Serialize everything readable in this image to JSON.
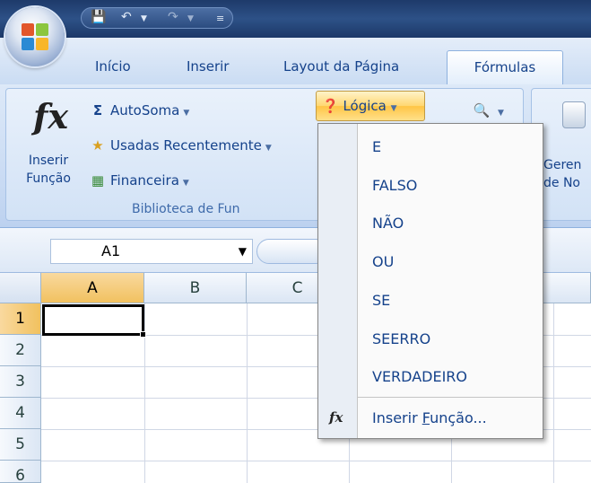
{
  "qat": {
    "icons": [
      "save-icon",
      "undo-icon",
      "redo-icon",
      "customize-icon"
    ]
  },
  "tabs": [
    {
      "label": "Início",
      "active": false
    },
    {
      "label": "Inserir",
      "active": false
    },
    {
      "label": "Layout da Página",
      "active": false
    },
    {
      "label": "Fórmulas",
      "active": true
    }
  ],
  "ribbon": {
    "insert_function": {
      "icon": "fx",
      "line1": "Inserir",
      "line2": "Função"
    },
    "autosum": {
      "icon": "Σ",
      "label": "AutoSoma"
    },
    "recent": {
      "label": "Usadas Recentemente"
    },
    "financial": {
      "label": "Financeira"
    },
    "logical": {
      "label": "Lógica"
    },
    "group_label": "Biblioteca de Fun",
    "right_text": {
      "line1": "Geren",
      "line2": "de No"
    }
  },
  "formula_bar": {
    "name_box": "A1"
  },
  "grid": {
    "columns": [
      "A",
      "B",
      "C"
    ],
    "rows": [
      "1",
      "2",
      "3",
      "4",
      "5",
      "6"
    ],
    "selected_cell": "A1"
  },
  "menu": {
    "items": [
      "E",
      "FALSO",
      "NÃO",
      "OU",
      "SE",
      "SEERRO",
      "VERDADEIRO"
    ],
    "insert_function": {
      "icon": "fx",
      "before": "Inserir ",
      "underline": "F",
      "after": "unção..."
    }
  },
  "colors": {
    "accent_highlight": "#ffd771",
    "text": "#15428b",
    "selected_header": "#f1c15f"
  }
}
